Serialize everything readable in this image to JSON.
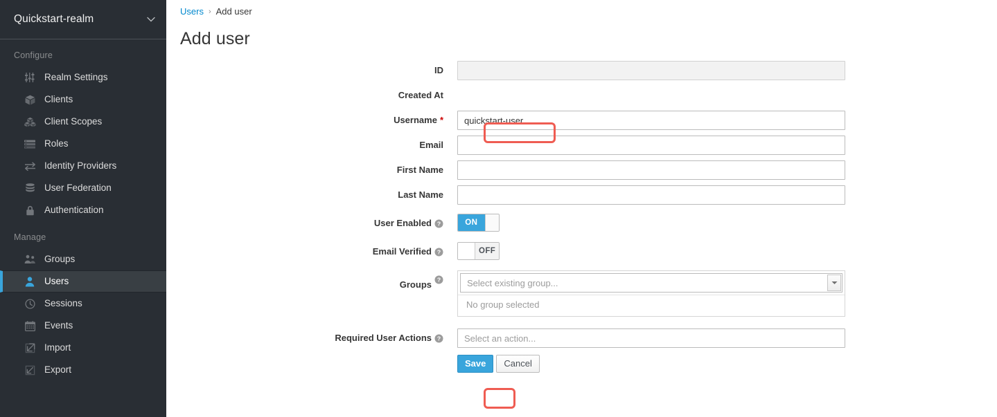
{
  "sidebar": {
    "realm": {
      "name": "Quickstart-realm",
      "caret": "chevron-down-icon"
    },
    "sections": [
      {
        "title": "Configure",
        "items": [
          {
            "label": "Realm Settings",
            "icon": "sliders-icon",
            "active": false
          },
          {
            "label": "Clients",
            "icon": "cube-icon",
            "active": false
          },
          {
            "label": "Client Scopes",
            "icon": "cubes-icon",
            "active": false
          },
          {
            "label": "Roles",
            "icon": "list-icon",
            "active": false
          },
          {
            "label": "Identity Providers",
            "icon": "exchange-arrows-icon",
            "active": false
          },
          {
            "label": "User Federation",
            "icon": "database-icon",
            "active": false
          },
          {
            "label": "Authentication",
            "icon": "lock-icon",
            "active": false
          }
        ]
      },
      {
        "title": "Manage",
        "items": [
          {
            "label": "Groups",
            "icon": "users-group-icon",
            "active": false
          },
          {
            "label": "Users",
            "icon": "user-icon",
            "active": true
          },
          {
            "label": "Sessions",
            "icon": "clock-icon",
            "active": false
          },
          {
            "label": "Events",
            "icon": "calendar-icon",
            "active": false
          },
          {
            "label": "Import",
            "icon": "import-arrow-icon",
            "active": false
          },
          {
            "label": "Export",
            "icon": "export-arrow-icon",
            "active": false
          }
        ]
      }
    ]
  },
  "breadcrumb": {
    "parent": "Users",
    "separator": "›",
    "current": "Add user"
  },
  "page": {
    "title": "Add user"
  },
  "form": {
    "id": {
      "label": "ID",
      "value": "",
      "placeholder": "",
      "disabled": true
    },
    "created_at": {
      "label": "Created At",
      "value": ""
    },
    "username": {
      "label": "Username",
      "required_marker": "*",
      "value": "quickstart-user",
      "placeholder": ""
    },
    "email": {
      "label": "Email",
      "value": "",
      "placeholder": ""
    },
    "first_name": {
      "label": "First Name",
      "value": "",
      "placeholder": ""
    },
    "last_name": {
      "label": "Last Name",
      "value": "",
      "placeholder": ""
    },
    "user_enabled": {
      "label": "User Enabled",
      "help": "help-circle-icon",
      "state": "ON",
      "on_label": "ON",
      "off_label": "OFF"
    },
    "email_verified": {
      "label": "Email Verified",
      "help": "help-circle-icon",
      "state": "OFF",
      "on_label": "ON",
      "off_label": "OFF"
    },
    "groups": {
      "label": "Groups",
      "help": "help-circle-icon",
      "select_placeholder": "Select existing group...",
      "empty_text": "No group selected",
      "caret": "caret-down-icon"
    },
    "required_user_actions": {
      "label": "Required User Actions",
      "help": "help-circle-icon",
      "placeholder": "Select an action...",
      "value": ""
    },
    "save_label": "Save",
    "cancel_label": "Cancel"
  },
  "annotations": {
    "username_highlight": "#ef5c52",
    "save_highlight": "#ef5c52"
  },
  "colors": {
    "sidebar_bg": "#292e34",
    "sidebar_active_bg": "#393f44",
    "accent_blue": "#39a5dc",
    "link_blue": "#0088ce",
    "annotation_red": "#ef5c52"
  }
}
